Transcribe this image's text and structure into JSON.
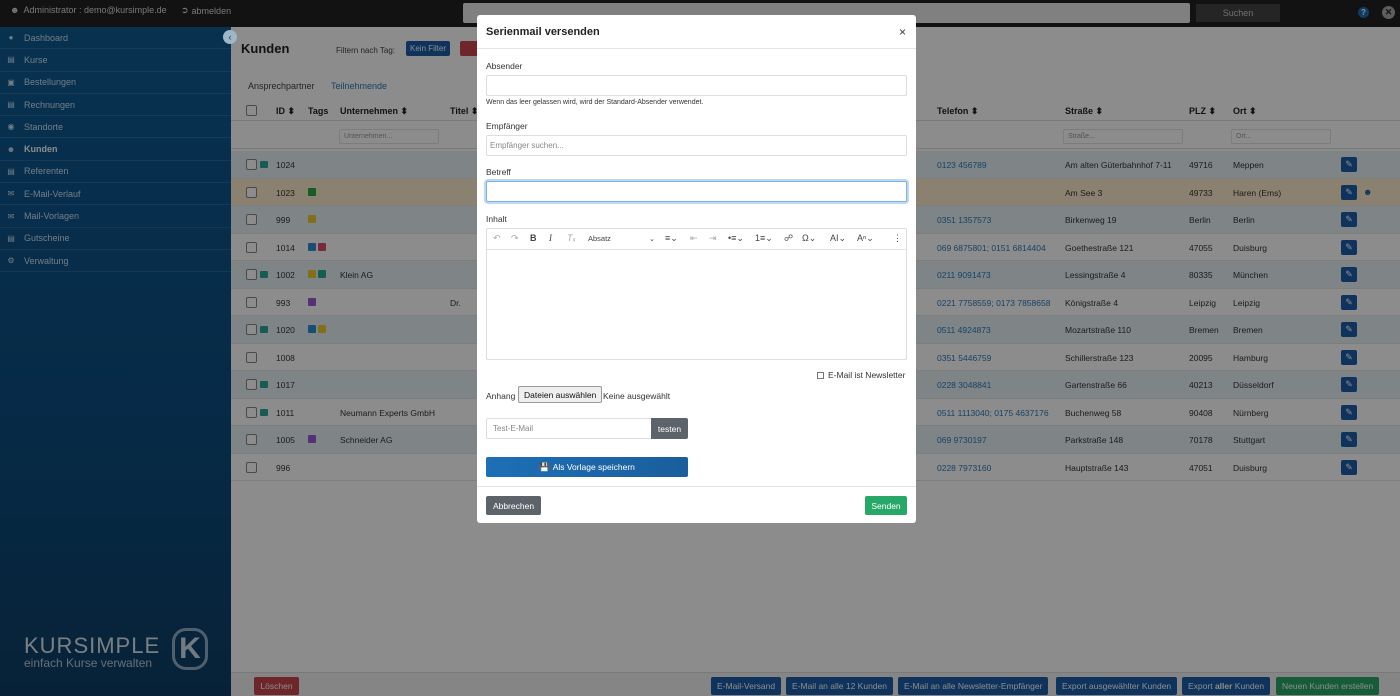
{
  "topbar": {
    "user_label": "Administrator : demo@kursimple.de",
    "logout_label": "abmelden",
    "search_value": "",
    "search_button": "Suchen",
    "help_glyph": "?",
    "close_glyph": "✕"
  },
  "sidebar": {
    "items": [
      {
        "label": "Dashboard",
        "icon": "dashboard-icon"
      },
      {
        "label": "Kurse",
        "icon": "courses-icon"
      },
      {
        "label": "Bestellungen",
        "icon": "cart-icon"
      },
      {
        "label": "Rechnungen",
        "icon": "invoice-icon"
      },
      {
        "label": "Standorte",
        "icon": "location-icon"
      },
      {
        "label": "Kunden",
        "icon": "users-icon"
      },
      {
        "label": "Referenten",
        "icon": "speaker-icon"
      },
      {
        "label": "E-Mail-Verlauf",
        "icon": "email-icon"
      },
      {
        "label": "Mail-Vorlagen",
        "icon": "template-icon"
      },
      {
        "label": "Gutscheine",
        "icon": "gift-icon"
      },
      {
        "label": "Verwaltung",
        "icon": "gear-icon"
      }
    ],
    "active_index": 5,
    "logo_name": "KURSIMPLE",
    "logo_sub": "einfach Kurse verwalten",
    "logo_letter": "K"
  },
  "main": {
    "title": "Kunden",
    "filter_label": "Filtern nach Tag:",
    "filter_button": "Kein Filter",
    "subtabs": [
      "Ansprechpartner",
      "Teilnehmende"
    ],
    "columns": {
      "id": "ID ⬍",
      "tags": "Tags",
      "company": "Unternehmen ⬍",
      "title": "Titel ⬍",
      "phone": "Telefon ⬍",
      "street": "Straße ⬍",
      "zip": "PLZ ⬍",
      "city": "Ort ⬍"
    },
    "filters": {
      "company": "Unternehmen...",
      "street": "Straße...",
      "city": "Ort..."
    },
    "rows": [
      {
        "id": "1024",
        "company": "",
        "title": "",
        "phone": "0123 456789",
        "street": "Am alten Güterbahnhof 7-11",
        "zip": "49716",
        "city": "Meppen"
      },
      {
        "id": "1023",
        "company": "",
        "title": "",
        "phone": "",
        "street": "Am See 3",
        "zip": "49733",
        "city": "Haren (Ems)"
      },
      {
        "id": "999",
        "company": "",
        "title": "",
        "phone": "0351 1357573",
        "street": "Birkenweg 19",
        "zip": "Berlin",
        "city": "Berlin"
      },
      {
        "id": "1014",
        "company": "",
        "title": "",
        "phone": "069 6875801; 0151 6814404",
        "street": "Goethestraße 121",
        "zip": "47055",
        "city": "Duisburg"
      },
      {
        "id": "1002",
        "company": "Klein AG",
        "title": "",
        "phone": "0211 9091473",
        "street": "Lessingstraße 4",
        "zip": "80335",
        "city": "München"
      },
      {
        "id": "993",
        "company": "",
        "title": "Dr.",
        "phone": "0221 7758559; 0173 7858658",
        "street": "Königstraße 4",
        "zip": "Leipzig",
        "city": "Leipzig"
      },
      {
        "id": "1020",
        "company": "",
        "title": "",
        "phone": "0511 4924873",
        "street": "Mozartstraße 110",
        "zip": "Bremen",
        "city": "Bremen"
      },
      {
        "id": "1008",
        "company": "",
        "title": "",
        "phone": "0351 5446759",
        "street": "Schillerstraße 123",
        "zip": "20095",
        "city": "Hamburg"
      },
      {
        "id": "1017",
        "company": "",
        "title": "",
        "phone": "0228 3048841",
        "street": "Gartenstraße 66",
        "zip": "40213",
        "city": "Düsseldorf"
      },
      {
        "id": "1011",
        "company": "Neumann Experts GmbH",
        "title": "",
        "phone": "0511 1113040; 0175 4637176",
        "street": "Buchenweg 58",
        "zip": "90408",
        "city": "Nürnberg"
      },
      {
        "id": "1005",
        "company": "Schneider AG",
        "title": "",
        "phone": "069 9730197",
        "street": "Parkstraße 148",
        "zip": "70178",
        "city": "Stuttgart"
      },
      {
        "id": "996",
        "company": "",
        "title": "",
        "phone": "0228 7973160",
        "street": "Hauptstraße 143",
        "zip": "47051",
        "city": "Duisburg"
      }
    ],
    "bottom_buttons": {
      "delete": "Löschen",
      "email_send": "E-Mail-Versand",
      "email_all": "E-Mail an alle 12 Kunden",
      "email_newsletter": "E-Mail an alle Newsletter-Empfänger",
      "export_selected": "Export ausgewählter Kunden",
      "export_all_prefix": "Export ",
      "export_all_bold": "aller",
      "export_all_suffix": " Kunden",
      "new_customer": "Neuen Kunden erstellen"
    }
  },
  "modal": {
    "title": "Serienmail versenden",
    "close_glyph": "×",
    "sender_label": "Absender",
    "sender_value": "",
    "sender_hint": "Wenn das leer gelassen wird, wird der Standard-Absender verwendet.",
    "recipient_label": "Empfänger",
    "recipient_placeholder": "Empfänger suchen...",
    "subject_label": "Betreff",
    "subject_value": "",
    "content_label": "Inhalt",
    "paragraph_select": "Absatz",
    "newsletter_label": "E-Mail ist Newsletter",
    "attachment_label": "Anhang",
    "attachment_button": "Dateien auswählen",
    "attachment_none": "Keine ausgewählt",
    "testmail_placeholder": "Test-E-Mail",
    "test_button": "testen",
    "save_template_button": "Als Vorlage speichern",
    "cancel_button": "Abbrechen",
    "send_button": "Senden"
  },
  "colors": {
    "primary": "#1c5ea8",
    "success": "#28a868",
    "danger": "#c8454f",
    "sidebar": "#0f5a93",
    "teal": "#2aa89a"
  }
}
